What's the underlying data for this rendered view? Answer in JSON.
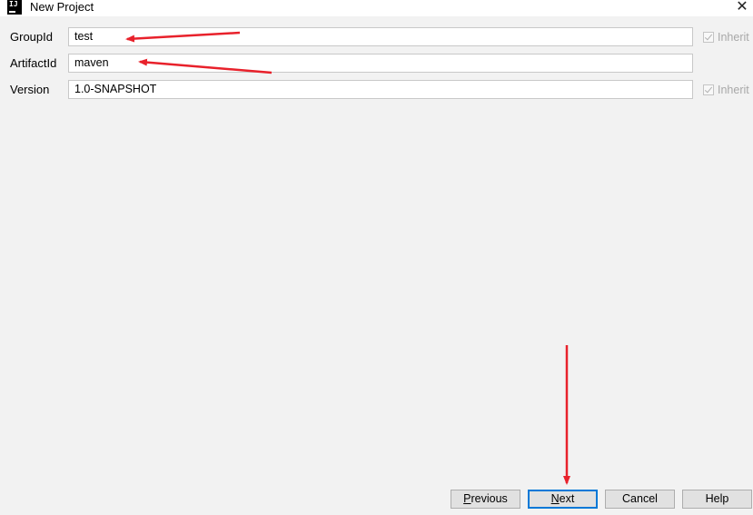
{
  "window": {
    "title": "New Project",
    "close_glyph": "✕",
    "icon": "intellij-idea-icon",
    "icon_text": "IJ"
  },
  "form": {
    "group_id": {
      "label": "GroupId",
      "value": "test",
      "inherit_label": "Inherit",
      "inherit_checked": true
    },
    "artifact_id": {
      "label": "ArtifactId",
      "value": "maven"
    },
    "version": {
      "label": "Version",
      "value": "1.0-SNAPSHOT",
      "inherit_label": "Inherit",
      "inherit_checked": true
    }
  },
  "buttons": {
    "previous": {
      "mnemonic": "P",
      "rest": "revious"
    },
    "next": {
      "mnemonic": "N",
      "rest": "ext"
    },
    "cancel": "Cancel",
    "help": "Help"
  },
  "annotations": {
    "arrow_color": "#e8212b"
  }
}
